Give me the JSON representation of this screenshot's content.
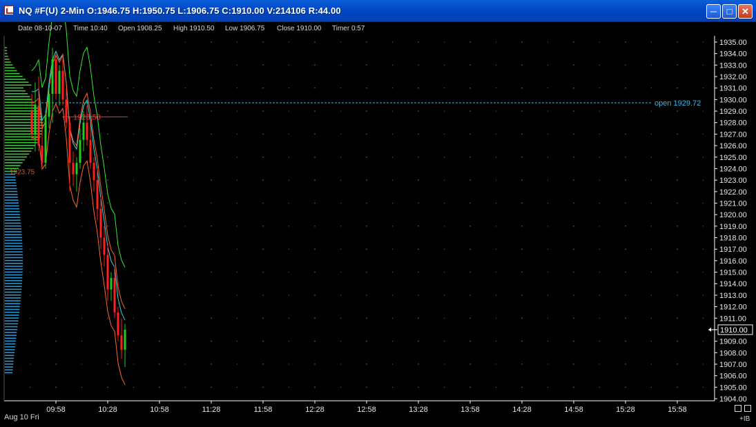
{
  "window": {
    "title": "NQ #F(U)  2-Min  O:1946.75  H:1950.75  L:1906.75  C:1910.00  V:214106  R:44.00",
    "icons": {
      "app": "chart-app-icon",
      "minimize": "minimize-icon",
      "maximize": "maximize-icon",
      "close": "close-icon"
    }
  },
  "info_bar": {
    "date": "Date 08-10-07",
    "time": "Time 10:40",
    "open": "Open 1908.25",
    "high": "High 1910.50",
    "low": "Low 1906.75",
    "close": "Close 1910.00",
    "timer": "Timer 0:57"
  },
  "colors": {
    "background": "#000000",
    "up_bar": "#22cc22",
    "down_bar": "#ff2020",
    "profile_green": "#40d040",
    "profile_blue": "#2a9fdf",
    "open_line": "#38b8e8",
    "band_green": "#33ee33",
    "band_orange": "#ff6a2a",
    "band_cyan": "#33dddd"
  },
  "chart_data": {
    "type": "candlestick",
    "symbol": "NQ #F(U)",
    "interval": "2-Min",
    "ylim": [
      1904.0,
      1935.0
    ],
    "y_ticks": [
      "1935.00",
      "1934.00",
      "1933.00",
      "1932.00",
      "1931.00",
      "1930.00",
      "1929.00",
      "1928.00",
      "1927.00",
      "1926.00",
      "1925.00",
      "1924.00",
      "1923.00",
      "1922.00",
      "1921.00",
      "1920.00",
      "1919.00",
      "1918.00",
      "1917.00",
      "1916.00",
      "1915.00",
      "1914.00",
      "1913.00",
      "1912.00",
      "1911.00",
      "1910.00",
      "1909.00",
      "1908.00",
      "1907.00",
      "1906.00",
      "1905.00",
      "1904.00"
    ],
    "x_ticks": [
      "09:58",
      "10:28",
      "10:58",
      "11:28",
      "11:58",
      "12:28",
      "12:58",
      "13:28",
      "13:58",
      "14:28",
      "14:58",
      "15:28",
      "15:58"
    ],
    "x_tick_minutes": [
      598,
      628,
      658,
      688,
      718,
      748,
      778,
      808,
      838,
      868,
      898,
      928,
      958
    ],
    "date_label": "Aug 10 Fri",
    "current_price_label": "1910.00",
    "current_price": 1910.0,
    "open_line": {
      "value": 1929.72,
      "label": "open 1929.72"
    },
    "poc_marker": {
      "value": 1928.5,
      "label": "1928.50"
    },
    "value_low_marker": {
      "value": 1923.75,
      "label": "1923.75"
    },
    "ib_label": "+IB",
    "bars": [
      {
        "t": 584,
        "o": 1929.0,
        "h": 1930.5,
        "l": 1926.5,
        "c": 1927.0
      },
      {
        "t": 586,
        "o": 1927.0,
        "h": 1931.5,
        "l": 1925.5,
        "c": 1929.5
      },
      {
        "t": 588,
        "o": 1929.5,
        "h": 1932.0,
        "l": 1925.5,
        "c": 1926.0
      },
      {
        "t": 590,
        "o": 1926.0,
        "h": 1928.0,
        "l": 1924.0,
        "c": 1924.5
      },
      {
        "t": 592,
        "o": 1924.5,
        "h": 1929.0,
        "l": 1924.0,
        "c": 1928.5
      },
      {
        "t": 594,
        "o": 1928.5,
        "h": 1931.0,
        "l": 1927.5,
        "c": 1930.5
      },
      {
        "t": 596,
        "o": 1930.5,
        "h": 1934.5,
        "l": 1928.0,
        "c": 1933.5
      },
      {
        "t": 598,
        "o": 1933.5,
        "h": 1934.0,
        "l": 1930.0,
        "c": 1930.5
      },
      {
        "t": 600,
        "o": 1930.5,
        "h": 1933.0,
        "l": 1929.5,
        "c": 1932.5
      },
      {
        "t": 602,
        "o": 1932.5,
        "h": 1934.0,
        "l": 1929.5,
        "c": 1930.0
      },
      {
        "t": 604,
        "o": 1930.0,
        "h": 1931.0,
        "l": 1927.5,
        "c": 1928.0
      },
      {
        "t": 606,
        "o": 1928.0,
        "h": 1928.5,
        "l": 1922.0,
        "c": 1924.5
      },
      {
        "t": 608,
        "o": 1924.5,
        "h": 1925.5,
        "l": 1922.5,
        "c": 1923.5
      },
      {
        "t": 610,
        "o": 1923.5,
        "h": 1925.0,
        "l": 1922.0,
        "c": 1924.5
      },
      {
        "t": 612,
        "o": 1924.5,
        "h": 1927.5,
        "l": 1924.0,
        "c": 1926.5
      },
      {
        "t": 614,
        "o": 1926.5,
        "h": 1929.0,
        "l": 1925.5,
        "c": 1928.0
      },
      {
        "t": 616,
        "o": 1928.0,
        "h": 1929.5,
        "l": 1926.0,
        "c": 1926.5
      },
      {
        "t": 618,
        "o": 1926.5,
        "h": 1928.0,
        "l": 1924.0,
        "c": 1924.5
      },
      {
        "t": 620,
        "o": 1924.5,
        "h": 1925.0,
        "l": 1922.0,
        "c": 1923.0
      },
      {
        "t": 622,
        "o": 1923.0,
        "h": 1924.0,
        "l": 1919.5,
        "c": 1920.5
      },
      {
        "t": 624,
        "o": 1920.5,
        "h": 1921.5,
        "l": 1917.0,
        "c": 1918.0
      },
      {
        "t": 626,
        "o": 1918.0,
        "h": 1919.0,
        "l": 1915.5,
        "c": 1916.5
      },
      {
        "t": 628,
        "o": 1916.5,
        "h": 1917.5,
        "l": 1912.5,
        "c": 1913.5
      },
      {
        "t": 630,
        "o": 1913.5,
        "h": 1915.0,
        "l": 1912.5,
        "c": 1914.5
      },
      {
        "t": 632,
        "o": 1914.5,
        "h": 1915.5,
        "l": 1911.0,
        "c": 1911.5
      },
      {
        "t": 634,
        "o": 1911.5,
        "h": 1912.0,
        "l": 1909.0,
        "c": 1909.5
      },
      {
        "t": 636,
        "o": 1909.5,
        "h": 1911.0,
        "l": 1907.5,
        "c": 1908.25
      },
      {
        "t": 638,
        "o": 1908.25,
        "h": 1910.5,
        "l": 1906.75,
        "c": 1910.0
      }
    ]
  }
}
